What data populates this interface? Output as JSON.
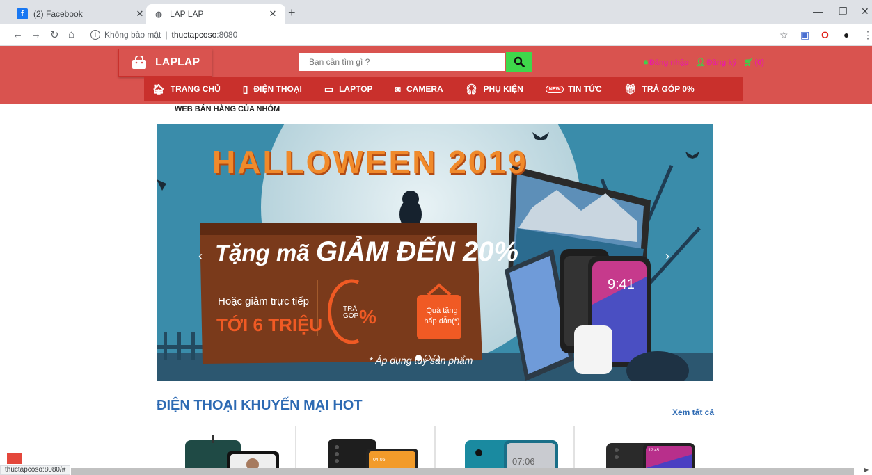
{
  "browser": {
    "tabs": [
      {
        "title": "(2) Facebook",
        "favicon": "facebook-icon"
      },
      {
        "title": "LAP LAP",
        "favicon": "globe-icon"
      }
    ],
    "security_label": "Không bảo mật",
    "url_host": "thuctapcoso",
    "url_port": ":8080",
    "status_url": "thuctapcoso:8080/#"
  },
  "header": {
    "logo_text": "LAPLAP",
    "search_placeholder": "Bạn cần tìm gì ?",
    "login_label": "Đăng nhập",
    "register_label": "Đăng ký",
    "cart_count": "(0)"
  },
  "nav": [
    {
      "label": "TRANG CHỦ",
      "icon": "home-icon"
    },
    {
      "label": "ĐIỆN THOẠI",
      "icon": "phone-icon"
    },
    {
      "label": "LAPTOP",
      "icon": "laptop-icon"
    },
    {
      "label": "CAMERA",
      "icon": "camera-icon"
    },
    {
      "label": "PHỤ KIỆN",
      "icon": "headphones-icon"
    },
    {
      "label": "TIN TỨC",
      "badge": "NEW"
    },
    {
      "label": "TRẢ GÓP 0%",
      "icon": "gift-icon"
    }
  ],
  "subtitle": "WEB BÁN HÀNG CỦA NHÓM",
  "banner": {
    "title": "HALLOWEEN 2019",
    "promo_prefix": "Tặng mã ",
    "promo_big": "GIẢM ĐẾN 20%",
    "sub1": "Hoặc giảm trực tiếp",
    "sub2": "TỚI 6 TRIỆU",
    "tra_gop_1": "TRẢ",
    "tra_gop_2": "GÓP",
    "percent": "%",
    "gift_1": "Quà tặng",
    "gift_2": "hấp dẫn(*)",
    "note": "* Áp dụng tùy sản phẩm",
    "phone_time": "9:41",
    "slide_count": 3,
    "active_slide": 1
  },
  "section": {
    "title": "ĐIỆN THOẠI KHUYẾN MẠI HOT",
    "see_all": "Xem tất cả"
  },
  "products": [
    {
      "screen_time": ""
    },
    {
      "screen_time": "04:05"
    },
    {
      "screen_time": "07:06"
    },
    {
      "screen_time": "12:45"
    }
  ],
  "colors": {
    "brand_red": "#d9534f",
    "nav_red": "#c9302c",
    "accent_green": "#3fd74b",
    "link_pink": "#e91ea0",
    "section_blue": "#2d6ab3"
  }
}
